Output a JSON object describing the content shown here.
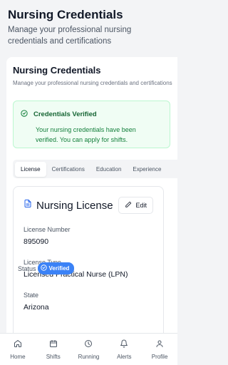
{
  "header": {
    "title": "Nursing Credentials",
    "subtitle": "Manage your professional nursing credentials and certifications"
  },
  "card": {
    "title": "Nursing Credentials",
    "subtitle": "Manage your professional nursing credentials and certifications",
    "verified": {
      "icon": "check-circle-icon",
      "title": "Credentials Verified",
      "text": "Your nursing credentials have been verified. You can apply for shifts."
    },
    "tabs": [
      {
        "label": "License",
        "active": true
      },
      {
        "label": "Certifications",
        "active": false
      },
      {
        "label": "Education",
        "active": false
      },
      {
        "label": "Experience",
        "active": false
      }
    ]
  },
  "license": {
    "icon": "document-icon",
    "title": "Nursing License",
    "edit_label": "Edit",
    "fields": [
      {
        "label": "License Number",
        "value": "895090"
      },
      {
        "label": "License Type",
        "value": "Licensed Practical Nurse (LPN)"
      },
      {
        "label": "State",
        "value": "Arizona"
      }
    ],
    "status_label": "Status",
    "status_badge": "Verified"
  },
  "nav": [
    {
      "label": "Home",
      "icon": "home-icon"
    },
    {
      "label": "Shifts",
      "icon": "calendar-icon"
    },
    {
      "label": "Running",
      "icon": "clock-icon"
    },
    {
      "label": "Alerts",
      "icon": "bell-icon"
    },
    {
      "label": "Profile",
      "icon": "user-icon"
    }
  ],
  "colors": {
    "accent": "#3b82f6",
    "verified_bg": "#f0fdf4",
    "verified_text": "#166534"
  }
}
